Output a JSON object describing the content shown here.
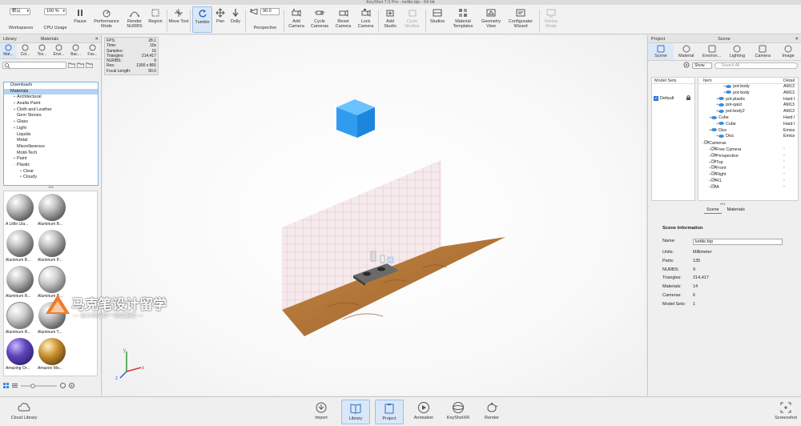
{
  "window": {
    "title": "KeyShot 7.0 Pro  -  kettle.bip  -  64 bit"
  },
  "toolbar": {
    "workspace_value": "默认",
    "cpu_value": "100 %",
    "fov_value": "90.0",
    "items": {
      "workspaces": "Workspaces",
      "cpu_usage": "CPU Usage",
      "pause": "Pause",
      "performance_mode": "Performance Mode",
      "render_nurbs": "Render NURBS",
      "region": "Region",
      "move_tool": "Move Tool",
      "tumble": "Tumble",
      "pan": "Pan",
      "dolly": "Dolly",
      "perspective": "Perspective",
      "add_camera": "Add Camera",
      "cycle_cameras": "Cycle Cameras",
      "reset_camera": "Reset Camera",
      "lock_camera": "Lock Camera",
      "add_studio": "Add Studio",
      "cycle_studios": "Cycle Studios",
      "studios": "Studios",
      "material_templates": "Material Templates",
      "geometry_view": "Geometry View",
      "configurator_wizard": "Configurator Wizard",
      "retina_mode": "Retina Mode"
    }
  },
  "library": {
    "header_left": "Library",
    "header_center": "Materials",
    "tabs": [
      "Mat...",
      "Col...",
      "Tex...",
      "Envi...",
      "Bac...",
      "Fav..."
    ],
    "tree": [
      {
        "label": "Downloads",
        "pm": "",
        "indent": 0,
        "italic": true,
        "selected": false
      },
      {
        "label": "Materials",
        "pm": "-",
        "indent": 0,
        "italic": false,
        "selected": true
      },
      {
        "label": "Architectural",
        "pm": "+",
        "indent": 1,
        "italic": false,
        "selected": false
      },
      {
        "label": "Axalta Paint",
        "pm": "+",
        "indent": 1,
        "italic": false,
        "selected": false
      },
      {
        "label": "Cloth and Leather",
        "pm": "+",
        "indent": 1,
        "italic": false,
        "selected": false
      },
      {
        "label": "Gem Stones",
        "pm": "",
        "indent": 1,
        "italic": false,
        "selected": false
      },
      {
        "label": "Glass",
        "pm": "+",
        "indent": 1,
        "italic": false,
        "selected": false
      },
      {
        "label": "Light",
        "pm": "+",
        "indent": 1,
        "italic": false,
        "selected": false
      },
      {
        "label": "Liquids",
        "pm": "",
        "indent": 1,
        "italic": false,
        "selected": false
      },
      {
        "label": "Metal",
        "pm": "",
        "indent": 1,
        "italic": false,
        "selected": false
      },
      {
        "label": "Miscellaneous",
        "pm": "",
        "indent": 1,
        "italic": false,
        "selected": false
      },
      {
        "label": "Mold-Tech",
        "pm": "",
        "indent": 1,
        "italic": false,
        "selected": false
      },
      {
        "label": "Paint",
        "pm": "+",
        "indent": 1,
        "italic": false,
        "selected": false
      },
      {
        "label": "Plastic",
        "pm": "-",
        "indent": 1,
        "italic": false,
        "selected": false
      },
      {
        "label": "Clear",
        "pm": "+",
        "indent": 2,
        "italic": false,
        "selected": false
      },
      {
        "label": "Cloudy",
        "pm": "+",
        "indent": 2,
        "italic": false,
        "selected": false
      }
    ],
    "thumbs": [
      {
        "name": "A Little Lila...",
        "kind": "metal"
      },
      {
        "name": "Aluminum B...",
        "kind": "metal"
      },
      {
        "name": "Aluminum B...",
        "kind": "metal"
      },
      {
        "name": "Aluminum P...",
        "kind": "metal"
      },
      {
        "name": "Aluminum R...",
        "kind": "metal"
      },
      {
        "name": "Aluminum R...",
        "kind": "dots"
      },
      {
        "name": "Aluminum R...",
        "kind": "dots"
      },
      {
        "name": "Aluminum T...",
        "kind": "metal"
      },
      {
        "name": "Amazing Or...",
        "kind": "purple"
      },
      {
        "name": "Amazon Mo...",
        "kind": "gold"
      }
    ],
    "cloud_library": "Cloud Library"
  },
  "hud": [
    {
      "k": "FPS:",
      "v": "28.1"
    },
    {
      "k": "Time:",
      "v": "10s"
    },
    {
      "k": "Samples:",
      "v": "16"
    },
    {
      "k": "Triangles:",
      "v": "214,417"
    },
    {
      "k": "NURBS:",
      "v": "9"
    },
    {
      "k": "Res:",
      "v": "1300 x 865"
    },
    {
      "k": "Focal Length:",
      "v": "90.0"
    }
  ],
  "watermark": {
    "title": "马克笔设计留学",
    "subtitle": "— 设计类留学一站式服务 —"
  },
  "project": {
    "header_left": "Project",
    "header_center": "Scene",
    "tabs": [
      "Scene",
      "Material",
      "Environ...",
      "Lighting",
      "Camera",
      "Image"
    ],
    "show_label": "Show",
    "search_placeholder": "Search All",
    "model_sets_header": "Model Sets",
    "model_set_default": "Default",
    "item_header": "Item",
    "detail_header": "Detail",
    "tree": [
      {
        "name": "pot-body",
        "detail": "AM13",
        "depth": 3,
        "eye": true,
        "selected": false
      },
      {
        "name": "pot-body",
        "detail": "AM13",
        "depth": 3,
        "eye": true,
        "selected": false
      },
      {
        "name": "pot-plastic",
        "detail": "Hard I",
        "depth": 2,
        "eye": true,
        "selected": false
      },
      {
        "name": "pot-qaizi",
        "detail": "AM13",
        "depth": 2,
        "eye": true,
        "selected": false
      },
      {
        "name": "pot-body2",
        "detail": "AM13",
        "depth": 2,
        "eye": true,
        "selected": false
      },
      {
        "name": "Cube",
        "detail": "Hard I",
        "depth": 1,
        "eye": true,
        "selected": false
      },
      {
        "name": "Cube",
        "detail": "Hard I",
        "depth": 2,
        "eye": true,
        "selected": false
      },
      {
        "name": "Disc",
        "detail": "Emiss",
        "depth": 1,
        "eye": true,
        "selected": false
      },
      {
        "name": "Disc",
        "detail": "Emiss",
        "depth": 2,
        "eye": true,
        "selected": false
      },
      {
        "name": "Cameras",
        "detail": "",
        "depth": 0,
        "eye": false,
        "selected": false
      },
      {
        "name": "Free Camera",
        "detail": "-",
        "depth": 1,
        "eye": false,
        "selected": false
      },
      {
        "name": "Perspective",
        "detail": "-",
        "depth": 1,
        "eye": false,
        "selected": false
      },
      {
        "name": "Top",
        "detail": "-",
        "depth": 1,
        "eye": false,
        "selected": false
      },
      {
        "name": "Front",
        "detail": "-",
        "depth": 1,
        "eye": false,
        "selected": false
      },
      {
        "name": "Right",
        "detail": "-",
        "depth": 1,
        "eye": false,
        "selected": false
      },
      {
        "name": "R1",
        "detail": "-",
        "depth": 1,
        "eye": false,
        "selected": false
      },
      {
        "name": "A",
        "detail": "-",
        "depth": 1,
        "eye": false,
        "selected": false
      }
    ],
    "subtabs": [
      "Scene",
      "Materials"
    ],
    "info": {
      "title": "Scene Information",
      "name_label": "Name:",
      "name_value": "kettle.bip",
      "rows": [
        {
          "k": "Units:",
          "v": "Millimeter"
        },
        {
          "k": "Parts:",
          "v": "135"
        },
        {
          "k": "NURBS:",
          "v": "9"
        },
        {
          "k": "Triangles:",
          "v": "214,417"
        },
        {
          "k": "Materials:",
          "v": "14"
        },
        {
          "k": "Cameras:",
          "v": "6"
        },
        {
          "k": "Model Sets:",
          "v": "1"
        }
      ]
    }
  },
  "bottombar": {
    "import": "Import",
    "library": "Library",
    "project": "Project",
    "animation": "Animation",
    "keyshotxr": "KeyShotXR",
    "render": "Render",
    "screenshot": "Screenshot"
  },
  "colors": {
    "accent": "#3d88dc",
    "cube": "#2f9cf0",
    "floor": "#b67a38"
  }
}
